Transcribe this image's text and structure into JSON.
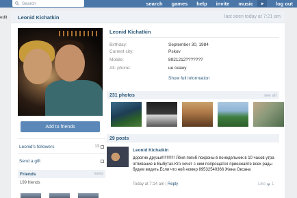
{
  "topbar": {
    "search_placeholder": "Search",
    "nav": [
      "search",
      "games",
      "help",
      "invite",
      "music"
    ],
    "logout": "log out"
  },
  "sidebar_stub": "edit",
  "profile": {
    "name": "Leonid Kichatkin",
    "last_seen": "last seen today at 7:21 am",
    "info": [
      {
        "key": "Birthday:",
        "value": "September 30, 1984"
      },
      {
        "key": "Current city:",
        "value": "Pskov"
      },
      {
        "key": "Mobile:",
        "value": "8921212???????"
      },
      {
        "key": "Alt. phone:",
        "value": "не скажу"
      }
    ],
    "show_full": "Show full information"
  },
  "actions": {
    "add_to_friends": "Add to friends",
    "followers_label": "Leonid's followers",
    "followers_count": "13",
    "send_gift": "Send a gift"
  },
  "friends": {
    "title": "Friends",
    "link": "news",
    "count": "199 friends"
  },
  "photos": {
    "title": "231 photos",
    "see_all": "see all"
  },
  "posts": {
    "title": "29 posts",
    "author": "Leonid Kichatkin",
    "text": "дорогие друзья!!!!!!!!!!! Лёня погиб похроны в понедельник в 10 часов утра отпивание в Выбутах.Кто хочет с ним попрощатся приезжайте всех рады будем видеть.Если что ной номер 89532540366 Жена Оксана",
    "time": "Today at 7:14 am",
    "reply": "Reply",
    "like": "Like",
    "like_count": "1"
  },
  "colors": {
    "topbar": "#4a76a8",
    "link": "#2b587a",
    "button": "#5b88b8"
  }
}
